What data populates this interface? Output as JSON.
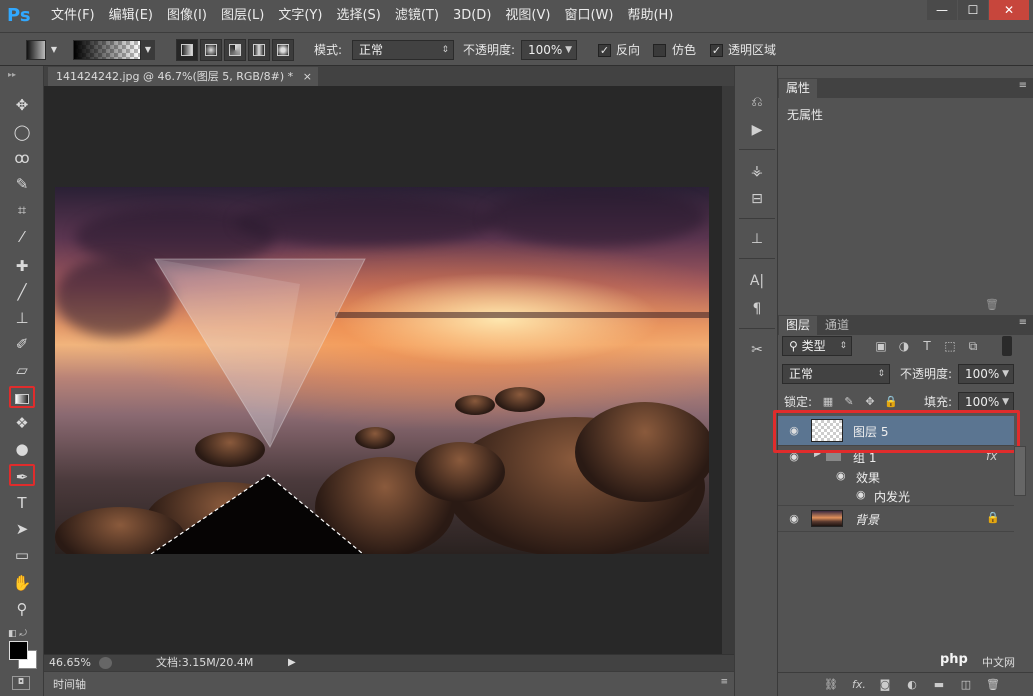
{
  "app": {
    "logo": "Ps"
  },
  "menu": [
    "文件(F)",
    "编辑(E)",
    "图像(I)",
    "图层(L)",
    "文字(Y)",
    "选择(S)",
    "滤镜(T)",
    "3D(D)",
    "视图(V)",
    "窗口(W)",
    "帮助(H)"
  ],
  "window_controls": {
    "minimize": "—",
    "restore": "☐",
    "close": "✕"
  },
  "options": {
    "mode_label": "模式:",
    "mode_value": "正常",
    "opacity_label": "不透明度:",
    "opacity_value": "100%",
    "reverse_label": "反向",
    "reverse_checked": true,
    "dither_label": "仿色",
    "dither_checked": false,
    "transparency_label": "透明区域",
    "transparency_checked": true
  },
  "document": {
    "tab_title": "141424242.jpg @ 46.7%(图层 5, RGB/8#) *",
    "tab_close": "×",
    "zoom": "46.65%",
    "doc_info": "文档:3.15M/20.4M"
  },
  "timeline": {
    "label": "时间轴"
  },
  "properties_panel": {
    "tab": "属性",
    "body": "无属性"
  },
  "layers_panel": {
    "tabs": [
      "图层",
      "通道"
    ],
    "filter_kind": "类型",
    "blend_mode": "正常",
    "opacity_label": "不透明度:",
    "opacity_value": "100%",
    "lock_label": "锁定:",
    "fill_label": "填充:",
    "fill_value": "100%",
    "layers": [
      {
        "name": "图层 5",
        "selected": true,
        "visible": true
      },
      {
        "name": "组 1",
        "selected": false,
        "visible": true,
        "fx": "fx"
      },
      {
        "name": "效果",
        "sub": true
      },
      {
        "name": "内发光",
        "sub": true
      },
      {
        "name": "背景",
        "selected": false,
        "visible": true,
        "locked": true
      }
    ]
  },
  "watermark": {
    "brand": "php",
    "site": "中文网"
  },
  "colors": {
    "accent": "#e02c2c",
    "selection": "#5b7591",
    "ps_blue": "#31a8ff"
  }
}
